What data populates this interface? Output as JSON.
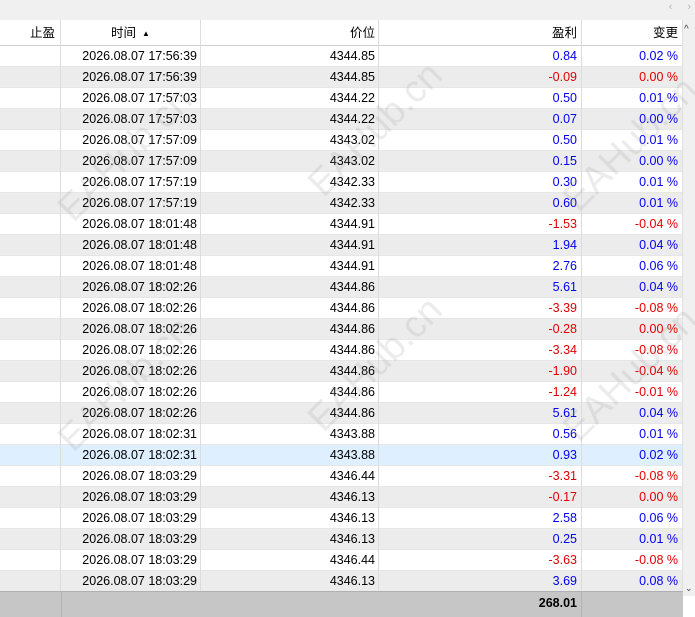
{
  "columns": {
    "stop_profit": "止盈",
    "time": "时间",
    "price": "价位",
    "profit": "盈利",
    "change": "变更"
  },
  "sort_indicator": "▲",
  "scroll_left": "‹",
  "scroll_right": "›",
  "scroll_up": "^",
  "scroll_down": "⌄",
  "watermark": "EAHub.cn",
  "rows": [
    {
      "time": "2026.08.07 17:56:39",
      "price": "4344.85",
      "profit": "0.84",
      "change": "0.02 %",
      "sign": "pos"
    },
    {
      "time": "2026.08.07 17:56:39",
      "price": "4344.85",
      "profit": "-0.09",
      "change": "0.00 %",
      "sign": "neg"
    },
    {
      "time": "2026.08.07 17:57:03",
      "price": "4344.22",
      "profit": "0.50",
      "change": "0.01 %",
      "sign": "pos"
    },
    {
      "time": "2026.08.07 17:57:03",
      "price": "4344.22",
      "profit": "0.07",
      "change": "0.00 %",
      "sign": "pos"
    },
    {
      "time": "2026.08.07 17:57:09",
      "price": "4343.02",
      "profit": "0.50",
      "change": "0.01 %",
      "sign": "pos"
    },
    {
      "time": "2026.08.07 17:57:09",
      "price": "4343.02",
      "profit": "0.15",
      "change": "0.00 %",
      "sign": "pos"
    },
    {
      "time": "2026.08.07 17:57:19",
      "price": "4342.33",
      "profit": "0.30",
      "change": "0.01 %",
      "sign": "pos"
    },
    {
      "time": "2026.08.07 17:57:19",
      "price": "4342.33",
      "profit": "0.60",
      "change": "0.01 %",
      "sign": "pos"
    },
    {
      "time": "2026.08.07 18:01:48",
      "price": "4344.91",
      "profit": "-1.53",
      "change": "-0.04 %",
      "sign": "neg"
    },
    {
      "time": "2026.08.07 18:01:48",
      "price": "4344.91",
      "profit": "1.94",
      "change": "0.04 %",
      "sign": "pos"
    },
    {
      "time": "2026.08.07 18:01:48",
      "price": "4344.91",
      "profit": "2.76",
      "change": "0.06 %",
      "sign": "pos"
    },
    {
      "time": "2026.08.07 18:02:26",
      "price": "4344.86",
      "profit": "5.61",
      "change": "0.04 %",
      "sign": "pos"
    },
    {
      "time": "2026.08.07 18:02:26",
      "price": "4344.86",
      "profit": "-3.39",
      "change": "-0.08 %",
      "sign": "neg"
    },
    {
      "time": "2026.08.07 18:02:26",
      "price": "4344.86",
      "profit": "-0.28",
      "change": "0.00 %",
      "sign": "neg"
    },
    {
      "time": "2026.08.07 18:02:26",
      "price": "4344.86",
      "profit": "-3.34",
      "change": "-0.08 %",
      "sign": "neg"
    },
    {
      "time": "2026.08.07 18:02:26",
      "price": "4344.86",
      "profit": "-1.90",
      "change": "-0.04 %",
      "sign": "neg"
    },
    {
      "time": "2026.08.07 18:02:26",
      "price": "4344.86",
      "profit": "-1.24",
      "change": "-0.01 %",
      "sign": "neg"
    },
    {
      "time": "2026.08.07 18:02:26",
      "price": "4344.86",
      "profit": "5.61",
      "change": "0.04 %",
      "sign": "pos"
    },
    {
      "time": "2026.08.07 18:02:31",
      "price": "4343.88",
      "profit": "0.56",
      "change": "0.01 %",
      "sign": "pos"
    },
    {
      "time": "2026.08.07 18:02:31",
      "price": "4343.88",
      "profit": "0.93",
      "change": "0.02 %",
      "sign": "pos",
      "selected": true
    },
    {
      "time": "2026.08.07 18:03:29",
      "price": "4346.44",
      "profit": "-3.31",
      "change": "-0.08 %",
      "sign": "neg"
    },
    {
      "time": "2026.08.07 18:03:29",
      "price": "4346.13",
      "profit": "-0.17",
      "change": "0.00 %",
      "sign": "neg"
    },
    {
      "time": "2026.08.07 18:03:29",
      "price": "4346.13",
      "profit": "2.58",
      "change": "0.06 %",
      "sign": "pos"
    },
    {
      "time": "2026.08.07 18:03:29",
      "price": "4346.13",
      "profit": "0.25",
      "change": "0.01 %",
      "sign": "pos"
    },
    {
      "time": "2026.08.07 18:03:29",
      "price": "4346.44",
      "profit": "-3.63",
      "change": "-0.08 %",
      "sign": "neg"
    },
    {
      "time": "2026.08.07 18:03:29",
      "price": "4346.13",
      "profit": "3.69",
      "change": "0.08 %",
      "sign": "pos"
    }
  ],
  "footer": {
    "total_profit": "268.01"
  },
  "colors": {
    "positive": "#0000ee",
    "negative": "#e00000",
    "selected_row": "#deefff",
    "footer": "#c6c6c6"
  }
}
